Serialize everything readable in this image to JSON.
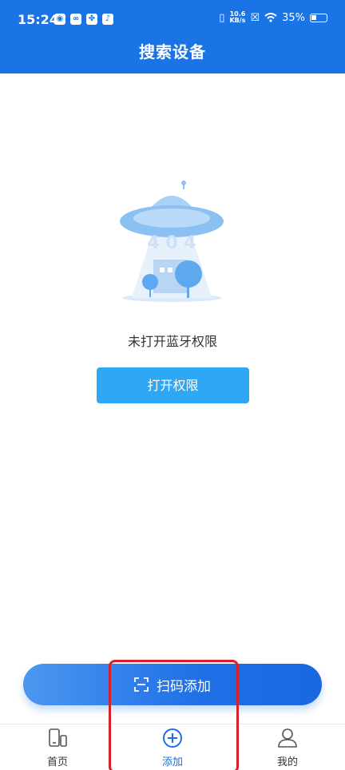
{
  "status_bar": {
    "time": "15:24",
    "app_icons": [
      "weibo-icon",
      "loop-icon",
      "fan-icon",
      "tiktok-icon"
    ],
    "net_speed_value": "10.6",
    "net_speed_unit": "KB/s",
    "battery": "35%"
  },
  "header": {
    "title": "搜索设备"
  },
  "empty_state": {
    "illustration": "ufo-404-icon",
    "message": "未打开蓝牙权限",
    "button_label": "打开权限"
  },
  "scan_button": {
    "label": "扫码添加",
    "icon": "scan-icon"
  },
  "tabbar": {
    "tabs": [
      {
        "label": "首页",
        "icon": "device-icon",
        "active": false
      },
      {
        "label": "添加",
        "icon": "add-circle-icon",
        "active": true
      },
      {
        "label": "我的",
        "icon": "user-icon",
        "active": false
      }
    ]
  },
  "colors": {
    "brand": "#1b74e6",
    "button": "#2ea8f5",
    "highlight": "#d8202a"
  }
}
